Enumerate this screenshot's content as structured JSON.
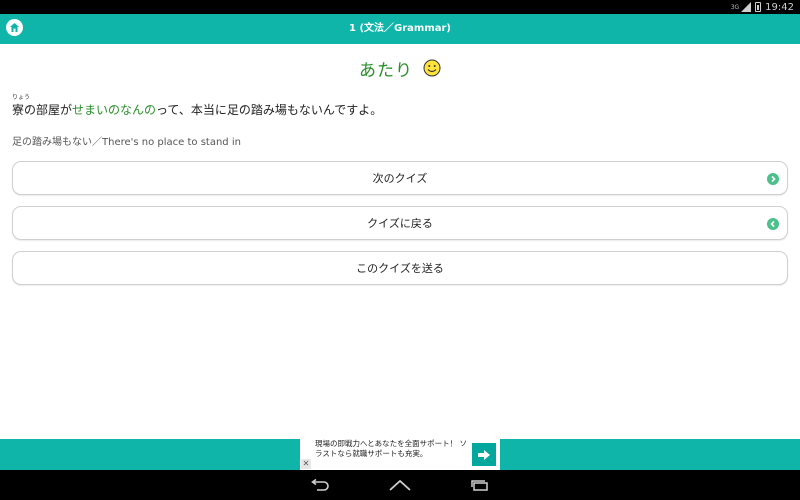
{
  "status_bar": {
    "network_label": "3G",
    "time": "19:42"
  },
  "app_bar": {
    "title": "1 (文法／Grammar)",
    "home_icon": "home-icon"
  },
  "result": {
    "text": "あたり",
    "icon": "smiley-icon",
    "color": "#2a8f2a"
  },
  "sentence": {
    "ruby": "りょう",
    "before": "寮の部屋が",
    "highlight": "せまいのなんの",
    "after": "って、本当に足の踏み場もないんですよ。"
  },
  "translation": "足の踏み場もない／There's no place to stand in",
  "buttons": {
    "next_label": "次のクイズ",
    "back_label": "クイズに戻る",
    "send_label": "このクイズを送る"
  },
  "ad": {
    "text": "現場の即戦力へとあなたを全面サポート！ ソラストなら就職サポートも充実。",
    "close_label": "✕"
  },
  "colors": {
    "accent": "#0fb5a9",
    "highlight": "#2a8f2a",
    "arrow": "#4cc08a"
  }
}
